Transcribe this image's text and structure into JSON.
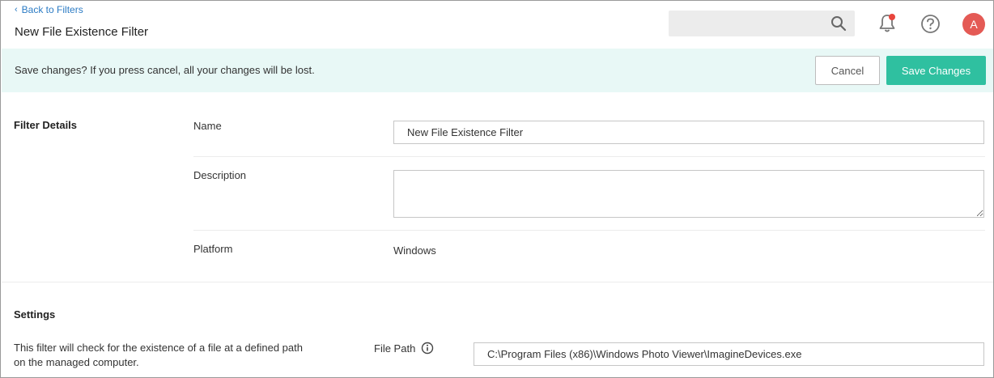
{
  "header": {
    "back_link": "Back to Filters",
    "title": "New File Existence Filter",
    "search": {
      "placeholder": "",
      "value": ""
    },
    "avatar_initial": "A"
  },
  "save_bar": {
    "message": "Save changes? If you press cancel, all your changes will be lost.",
    "cancel_label": "Cancel",
    "save_label": "Save Changes"
  },
  "filter_details": {
    "title": "Filter Details",
    "name_label": "Name",
    "name_value": "New File Existence Filter",
    "description_label": "Description",
    "description_value": "",
    "platform_label": "Platform",
    "platform_value": "Windows"
  },
  "settings": {
    "title": "Settings",
    "description": "This filter will check for the existence of a file at a defined path on the managed computer.",
    "file_path_label": "File Path",
    "file_path_value": "C:\\Program Files (x86)\\Windows Photo Viewer\\ImagineDevices.exe"
  },
  "colors": {
    "accent": "#2fc0a0",
    "save_bar_bg": "#e8f8f6",
    "link": "#2b7bc4",
    "avatar": "#e45a55",
    "notification_dot": "#e8453c"
  },
  "icons": [
    "chevron-left-icon",
    "search-icon",
    "bell-icon",
    "help-icon",
    "info-icon"
  ]
}
